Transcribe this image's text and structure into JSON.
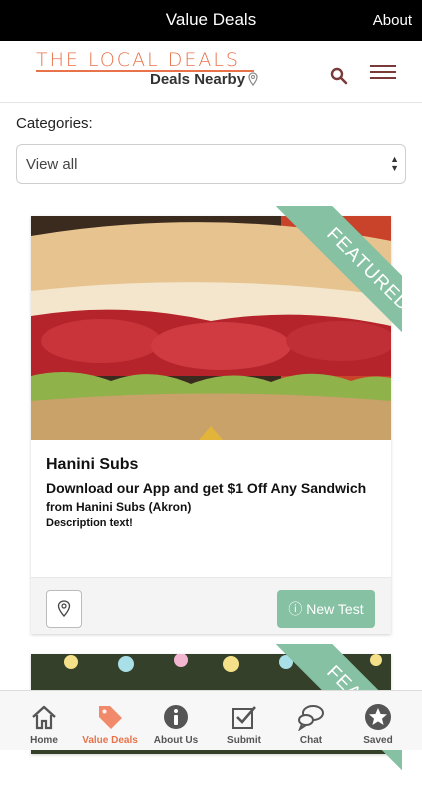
{
  "topbar": {
    "title": "Value Deals",
    "about": "About"
  },
  "logo": {
    "top": "THE LOCAL DEALS",
    "bottom": "Deals Nearby"
  },
  "categories": {
    "label": "Categories:",
    "selected": "View all"
  },
  "deals": [
    {
      "ribbon": "FEATURED",
      "business": "Hanini Subs",
      "title": "Download our App and get $1 Off Any Sandwich",
      "from": "from Hanini Subs (Akron)",
      "description": "Description text!",
      "action": "ⓘ New Test"
    },
    {
      "ribbon": "FEATURED"
    }
  ],
  "tabs": [
    {
      "label": "Home",
      "icon": "home-icon"
    },
    {
      "label": "Value Deals",
      "icon": "tag-icon"
    },
    {
      "label": "About Us",
      "icon": "info-icon"
    },
    {
      "label": "Submit",
      "icon": "checkbox-icon"
    },
    {
      "label": "Chat",
      "icon": "chat-icon"
    },
    {
      "label": "Saved",
      "icon": "star-icon"
    }
  ],
  "colors": {
    "accent": "#e8734a",
    "ribbon": "#86c1a3",
    "topbar": "#000000"
  }
}
